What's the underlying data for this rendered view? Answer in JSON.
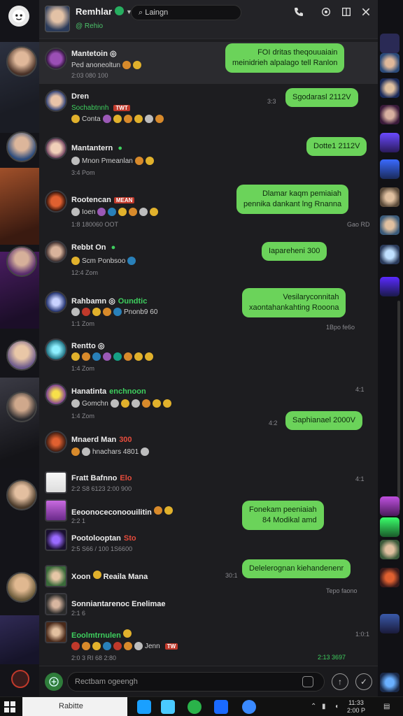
{
  "header": {
    "name": "Remhlar",
    "status": "@ Rehio",
    "search_value": "Laingn",
    "icons": [
      "phone-icon",
      "settings-icon",
      "layout-icon",
      "close-icon"
    ]
  },
  "chats": [
    {
      "name": "Mantetoin",
      "sub": "Ped anoneoltun",
      "time": "2:03 080 100",
      "active": true
    },
    {
      "name": "Dren",
      "sub_green": "Sochabtnnh",
      "tag": "TWT",
      "sub": "Conta",
      "time": ""
    },
    {
      "name": "Mantantern",
      "sub": "Mnon Pmeanlan",
      "time": "3:4 Pom"
    },
    {
      "name": "Rootencan",
      "tag": "MEAN",
      "sub": "Ioen",
      "time": "1:8 180060 OOT"
    },
    {
      "name": "Rebbt On",
      "sub": "Scm Ponbsoo",
      "time": "12:4 Zom"
    },
    {
      "name": "Rahbamn",
      "name_green": "Oundtic",
      "sub": "Pnonb9 60",
      "time": "1:1 Zom"
    },
    {
      "name": "Rentto",
      "sub": "",
      "time": "1:4 Zom"
    },
    {
      "name": "Hanatinta",
      "name_green": "enchnoon",
      "sub": "Gomchn",
      "time": "1:4 Zom"
    },
    {
      "name": "Mnaerd Man",
      "name_red": "300",
      "sub": "hnachars 4801",
      "time": ""
    },
    {
      "name": "Fratt Bafnno",
      "name_red": "Elo",
      "sub": "",
      "time": "2:2 S8 6123 2:00 900"
    },
    {
      "name": "Eeoonoceconoouilitin",
      "sub": "",
      "time": "2:2 1"
    },
    {
      "name": "Pootolooptan",
      "name_red": "Sto",
      "sub": "",
      "time": "2:5 S66 / 100 1S6600"
    },
    {
      "name": "Xoon",
      "name2": "Reaila Mana",
      "sub": "",
      "time": ""
    },
    {
      "name": "Sonniantarenoc Enelimae",
      "sub": "",
      "time": "2:1 6"
    },
    {
      "name": "Eoolmtrnulen",
      "sub": "Jenn",
      "time": "2:0 3 RI 68 2:80"
    }
  ],
  "messages": [
    {
      "text_lines": [
        "FOI dritas theqouuaiain",
        "meinidrieh alpalago tell Ranlon"
      ],
      "time": ""
    },
    {
      "text_lines": [
        "Sgodarasl 2112V"
      ],
      "time": "3:3"
    },
    {
      "text_lines": [
        "Dotte1 2112V"
      ],
      "time": ""
    },
    {
      "text_lines": [
        "Dlamar kaqm pemiaiah",
        "pennika dankant lng Rnanna"
      ],
      "time": "Gao RD"
    },
    {
      "text_lines": [
        "Iapareheni 300"
      ],
      "time": ""
    },
    {
      "text_lines": [
        "Vesilaryconnitah",
        "xaontahankahting Rooona"
      ],
      "time": "1Bpo fe6o"
    },
    {
      "text_lines": [
        "Saphianael 2000V"
      ],
      "time": ""
    },
    {
      "text_lines": [
        "Fonekam peeniaiah",
        "84 Modikal amd"
      ],
      "time": ""
    },
    {
      "text_lines": [
        "Delelerognan kiehandenenr"
      ],
      "time": "Tepo faono"
    }
  ],
  "message_meta": [
    "30:1",
    "4:1",
    "4:2",
    "1:0:1",
    "4:1",
    "2:13 3697"
  ],
  "composer": {
    "placeholder": "Rectbam ogeengh"
  },
  "taskbar": {
    "search": "Rabitte",
    "clock_time": "11:33",
    "clock_date": "2:00 P"
  }
}
